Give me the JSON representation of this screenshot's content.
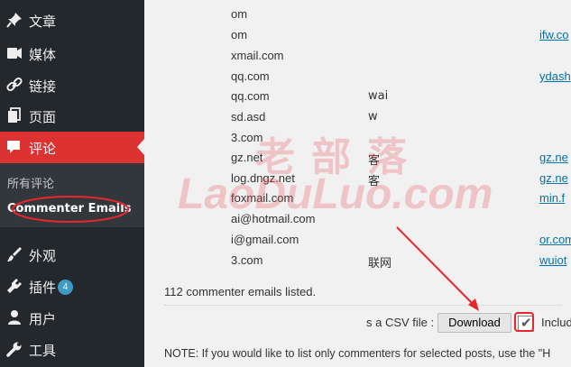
{
  "sidebar": {
    "items": [
      {
        "label": "文章",
        "icon": "pin-icon"
      },
      {
        "label": "媒体",
        "icon": "media-icon"
      },
      {
        "label": "链接",
        "icon": "link-icon"
      },
      {
        "label": "页面",
        "icon": "page-icon"
      },
      {
        "label": "评论",
        "icon": "comment-icon",
        "active": true
      },
      {
        "label": "外观",
        "icon": "brush-icon"
      },
      {
        "label": "插件",
        "icon": "plugin-icon",
        "badge": "4"
      },
      {
        "label": "用户",
        "icon": "user-icon"
      },
      {
        "label": "工具",
        "icon": "wrench-icon"
      }
    ],
    "submenu": {
      "all_comments": "所有评论",
      "commenter_emails": "Commenter Emails"
    }
  },
  "table": {
    "rows": [
      {
        "email": "om",
        "name": "",
        "url": ""
      },
      {
        "email": "om",
        "name": "",
        "url": "ifw.co"
      },
      {
        "email": "xmail.com",
        "name": "",
        "url": ""
      },
      {
        "email": "qq.com",
        "name": "",
        "url": "ydash"
      },
      {
        "email": "qq.com",
        "name": "wai",
        "url": ""
      },
      {
        "email": "sd.asd",
        "name": "w",
        "url": ""
      },
      {
        "email": "3.com",
        "name": "",
        "url": ""
      },
      {
        "email": "gz.net",
        "name": "客",
        "url": "gz.ne"
      },
      {
        "email": "log.dngz.net",
        "name": "客",
        "url": "gz.ne"
      },
      {
        "email": "foxmail.com",
        "name": "",
        "url": "min.f"
      },
      {
        "email": "ai@hotmail.com",
        "name": "",
        "url": ""
      },
      {
        "email": "i@gmail.com",
        "name": "",
        "url": "or.com"
      },
      {
        "email": "3.com",
        "name": "联网",
        "url": "wuiot"
      }
    ]
  },
  "summary": "112 commenter emails listed.",
  "download": {
    "label": "s a CSV file :",
    "button": "Download",
    "include_label": "Includ",
    "checked": true
  },
  "note": "NOTE: If you would like to list only commenters for selected posts, use the \"H",
  "watermark": {
    "cn": "老部落",
    "en": "LaoDuLuo.com"
  },
  "colors": {
    "sidebar_bg": "#23282d",
    "active_bg": "#dc3232",
    "link": "#0073aa",
    "annotation": "#e8262c"
  }
}
